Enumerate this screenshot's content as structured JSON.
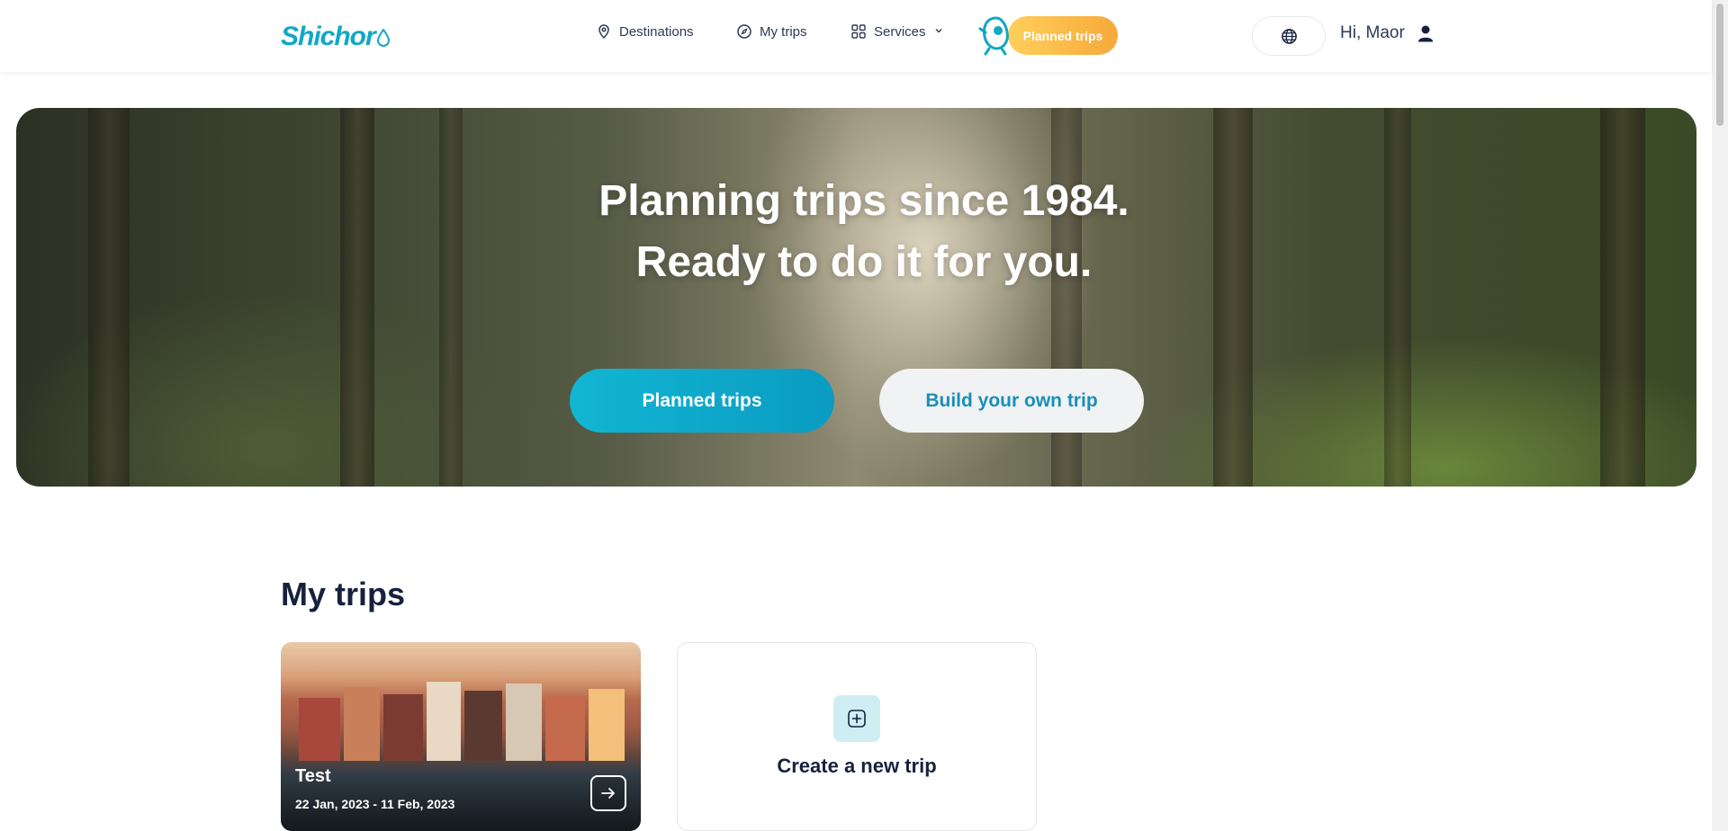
{
  "header": {
    "logo_text": "Shichor",
    "nav": {
      "destinations": "Destinations",
      "my_trips": "My trips",
      "services": "Services"
    },
    "planned_trips_button": "Planned trips",
    "greeting": "Hi, Maor"
  },
  "hero": {
    "title_line1": "Planning trips since 1984.",
    "title_line2": "Ready to do it for you.",
    "primary_button": "Planned trips",
    "secondary_button": "Build your own trip"
  },
  "my_trips": {
    "title": "My trips",
    "trips": [
      {
        "name": "Test",
        "dates": "22 Jan, 2023 - 11 Feb, 2023"
      }
    ],
    "create_label": "Create a new trip"
  },
  "colors": {
    "brand": "#11a8c4",
    "accent_orange": "#f6a93a",
    "text_dark": "#16213e"
  },
  "icons": [
    "location-pin-icon",
    "compass-icon",
    "grid-icon",
    "chevron-down-icon",
    "globe-icon",
    "user-icon",
    "arrow-right-icon",
    "plus-square-icon"
  ]
}
